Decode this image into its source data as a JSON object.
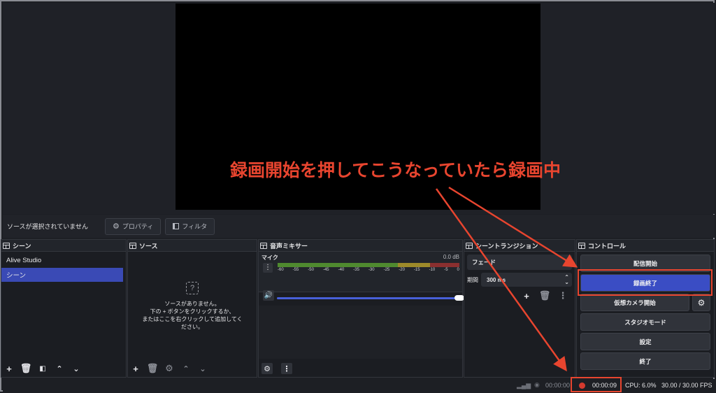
{
  "source_bar": {
    "no_selection": "ソースが選択されていません",
    "properties": "プロパティ",
    "filters": "フィルタ"
  },
  "docks": {
    "scenes": {
      "title": "シーン",
      "items": [
        "Alive Studio",
        "シーン"
      ],
      "selected_index": 1
    },
    "sources": {
      "title": "ソース",
      "empty_line1": "ソースがありません。",
      "empty_line2": "下の + ボタンをクリックするか、",
      "empty_line3": "またはここを右クリックして追加してく",
      "empty_line4": "ださい。"
    },
    "mixer": {
      "title": "音声ミキサー",
      "channel": "マイク",
      "db": "0.0 dB",
      "ticks": [
        "-60",
        "-55",
        "-50",
        "-45",
        "-40",
        "-35",
        "-30",
        "-25",
        "-20",
        "-15",
        "-10",
        "-5",
        "0"
      ],
      "volume_level": 1.0
    },
    "transitions": {
      "title": "シーントランジション",
      "type": "フェード",
      "duration_label": "期間",
      "duration_value": "300 ms"
    },
    "controls": {
      "title": "コントロール",
      "buttons": [
        "配信開始",
        "録画終了",
        "仮想カメラ開始",
        "スタジオモード",
        "設定",
        "終了"
      ]
    }
  },
  "status": {
    "stream_time": "00:00:00",
    "rec_time": "00:00:09",
    "cpu": "CPU: 6.0%",
    "fps": "30.00 / 30.00 FPS"
  },
  "annotation": {
    "text": "録画開始を押してこうなっていたら録画中"
  },
  "colors": {
    "accent": "#3a4dc4",
    "annotation": "#e8452f",
    "recording": "#d43a2e"
  }
}
